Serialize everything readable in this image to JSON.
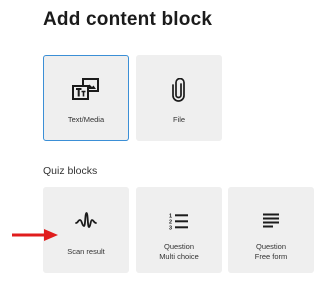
{
  "page": {
    "title": "Add content block"
  },
  "content_blocks": [
    {
      "label": "Text/Media",
      "icon": "text-media-icon",
      "selected": true
    },
    {
      "label": "File",
      "icon": "paperclip-icon",
      "selected": false
    }
  ],
  "quiz_section": {
    "label": "Quiz blocks",
    "blocks": [
      {
        "label": "Scan result",
        "icon": "waveform-icon"
      },
      {
        "label_line1": "Question",
        "label_line2": "Multi choice",
        "icon": "numbered-list-icon"
      },
      {
        "label_line1": "Question",
        "label_line2": "Free form",
        "icon": "lines-icon"
      }
    ]
  },
  "colors": {
    "selected_border": "#3b8fd6",
    "card_background": "#efefef",
    "annotation_arrow": "#e01c1c"
  }
}
